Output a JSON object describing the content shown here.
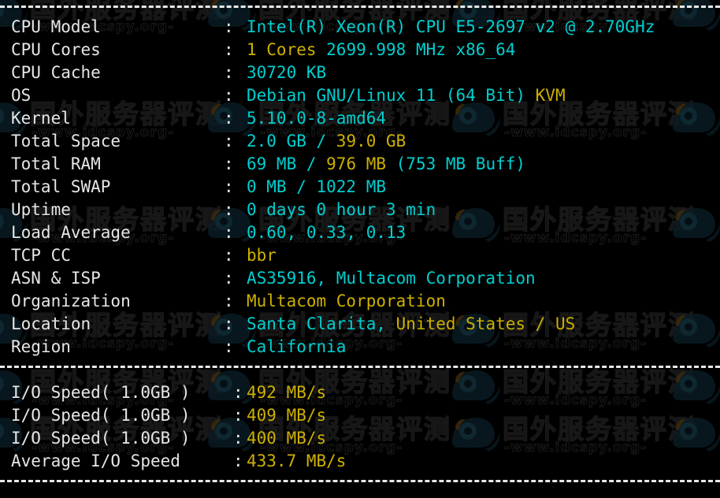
{
  "terminal": {
    "background": "#000000",
    "label_color": "#e6e6e6",
    "cyan": "#00cfd0",
    "gold": "#cdb000",
    "divider_char": "-"
  },
  "system_info": {
    "rows": [
      {
        "label": "CPU Model",
        "separator": ":",
        "segments": [
          {
            "text": "Intel(R) Xeon(R) CPU E5-2697 v2 @ 2.70GHz",
            "color": "cyan"
          }
        ]
      },
      {
        "label": "CPU Cores",
        "separator": ":",
        "segments": [
          {
            "text": "1 Cores",
            "color": "gold"
          },
          {
            "text": " 2699.998 MHz x86_64",
            "color": "cyan"
          }
        ]
      },
      {
        "label": "CPU Cache",
        "separator": ":",
        "segments": [
          {
            "text": "30720 KB",
            "color": "cyan"
          }
        ]
      },
      {
        "label": "OS",
        "separator": ":",
        "segments": [
          {
            "text": "Debian GNU/Linux 11 (64 Bit) ",
            "color": "cyan"
          },
          {
            "text": "KVM",
            "color": "gold"
          }
        ]
      },
      {
        "label": "Kernel",
        "separator": ":",
        "segments": [
          {
            "text": "5.10.0-8-amd64",
            "color": "cyan"
          }
        ]
      },
      {
        "label": "Total Space",
        "separator": ":",
        "segments": [
          {
            "text": "2.0 GB / ",
            "color": "cyan"
          },
          {
            "text": "39.0 GB",
            "color": "gold"
          }
        ]
      },
      {
        "label": "Total RAM",
        "separator": ":",
        "segments": [
          {
            "text": "69 MB / ",
            "color": "cyan"
          },
          {
            "text": "976 MB",
            "color": "gold"
          },
          {
            "text": " (753 MB Buff)",
            "color": "cyan"
          }
        ]
      },
      {
        "label": "Total SWAP",
        "separator": ":",
        "segments": [
          {
            "text": "0 MB / 1022 MB",
            "color": "cyan"
          }
        ]
      },
      {
        "label": "Uptime",
        "separator": ":",
        "segments": [
          {
            "text": "0 days 0 hour 3 min",
            "color": "cyan"
          }
        ]
      },
      {
        "label": "Load Average",
        "separator": ":",
        "segments": [
          {
            "text": "0.60, 0.33, 0.13",
            "color": "cyan"
          }
        ]
      },
      {
        "label": "TCP CC",
        "separator": ":",
        "segments": [
          {
            "text": "bbr",
            "color": "gold"
          }
        ]
      },
      {
        "label": "ASN & ISP",
        "separator": ":",
        "segments": [
          {
            "text": "AS35916, Multacom Corporation",
            "color": "cyan"
          }
        ]
      },
      {
        "label": "Organization",
        "separator": ":",
        "segments": [
          {
            "text": "Multacom Corporation",
            "color": "gold"
          }
        ]
      },
      {
        "label": "Location",
        "separator": ":",
        "segments": [
          {
            "text": "Santa Clarita, ",
            "color": "cyan"
          },
          {
            "text": "United States / US",
            "color": "gold"
          }
        ]
      },
      {
        "label": "Region",
        "separator": ":",
        "segments": [
          {
            "text": "California",
            "color": "cyan"
          }
        ]
      }
    ]
  },
  "io_benchmark": {
    "rows": [
      {
        "label": "I/O Speed( 1.0GB )",
        "separator": ":",
        "segments": [
          {
            "text": "492 MB/s",
            "color": "gold"
          }
        ]
      },
      {
        "label": "I/O Speed( 1.0GB )",
        "separator": ":",
        "segments": [
          {
            "text": "409 MB/s",
            "color": "gold"
          }
        ]
      },
      {
        "label": "I/O Speed( 1.0GB )",
        "separator": ":",
        "segments": [
          {
            "text": "400 MB/s",
            "color": "gold"
          }
        ]
      },
      {
        "label": "Average I/O Speed",
        "separator": ":",
        "segments": [
          {
            "text": "433.7 MB/s",
            "color": "gold"
          }
        ]
      }
    ]
  },
  "watermark": {
    "text": "国外服务器评测",
    "url": "-www.idcspy.org-"
  }
}
